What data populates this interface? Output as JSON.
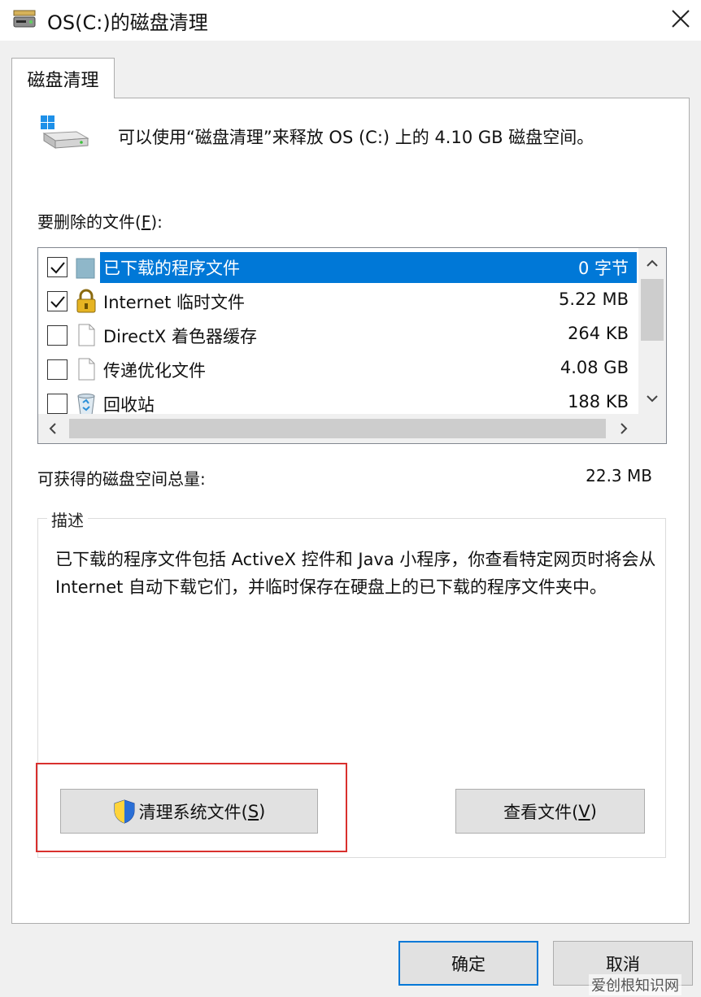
{
  "window": {
    "title": "OS(C:)的磁盘清理",
    "icon": "disk-cleanup-icon",
    "close_icon": "close-icon"
  },
  "tab": {
    "label": "磁盘清理"
  },
  "intro": {
    "text": "可以使用“磁盘清理”来释放 OS (C:) 上的 4.10 GB 磁盘空间。"
  },
  "files_section": {
    "label_prefix": "要删除的文件(",
    "label_accel": "F",
    "label_suffix": "):"
  },
  "file_list": [
    {
      "name": "已下载的程序文件",
      "size": "0 字节",
      "checked": true,
      "selected": true,
      "icon": "folder-icon"
    },
    {
      "name": "Internet 临时文件",
      "size": "5.22 MB",
      "checked": true,
      "selected": false,
      "icon": "lock-icon"
    },
    {
      "name": "DirectX 着色器缓存",
      "size": "264 KB",
      "checked": false,
      "selected": false,
      "icon": "file-icon"
    },
    {
      "name": "传递优化文件",
      "size": "4.08 GB",
      "checked": false,
      "selected": false,
      "icon": "file-icon"
    },
    {
      "name": "回收站",
      "size": "188 KB",
      "checked": false,
      "selected": false,
      "icon": "recycle-bin-icon"
    }
  ],
  "total": {
    "label": "可获得的磁盘空间总量:",
    "value": "22.3 MB"
  },
  "description": {
    "group_label": "描述",
    "text": "已下载的程序文件包括 ActiveX 控件和 Java 小程序，你查看特定网页时将会从 Internet 自动下载它们，并临时保存在硬盘上的已下载的程序文件夹中。"
  },
  "buttons": {
    "cleanup_system_prefix": "清理系统文件(",
    "cleanup_system_accel": "S",
    "cleanup_system_suffix": ")",
    "view_files_prefix": "查看文件(",
    "view_files_accel": "V",
    "view_files_suffix": ")",
    "ok": "确定",
    "cancel": "取消"
  },
  "annotation": {
    "highlight_color": "#d9302e"
  },
  "colors": {
    "selection": "#0078d7",
    "dialog_bg": "#f0f0f0"
  },
  "watermark": {
    "text": "爱创根知识网"
  }
}
